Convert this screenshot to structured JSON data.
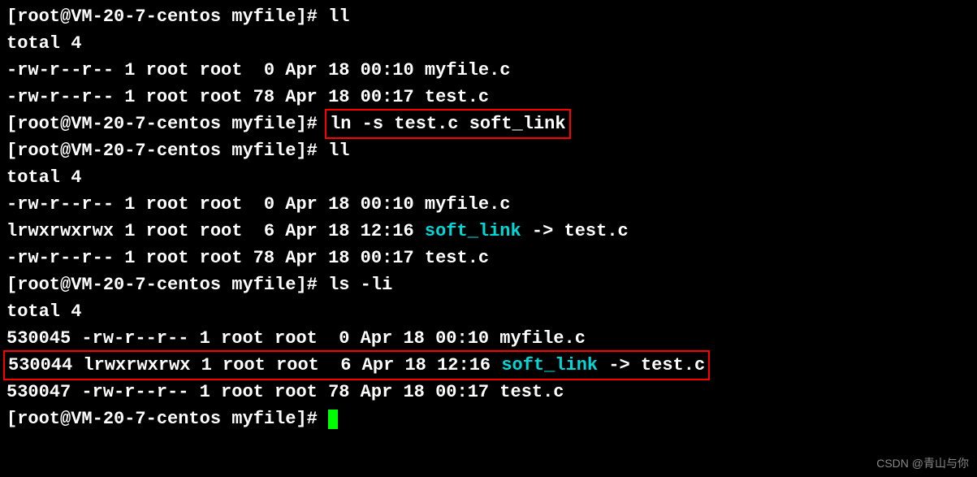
{
  "prompt": "[root@VM-20-7-centos myfile]# ",
  "cmd": {
    "ll1": "ll",
    "ln": "ln -s test.c soft_link",
    "ll2": "ll",
    "lsli": "ls -li"
  },
  "out": {
    "total": "total 4",
    "ll1_r1": "-rw-r--r-- 1 root root  0 Apr 18 00:10 myfile.c",
    "ll1_r2": "-rw-r--r-- 1 root root 78 Apr 18 00:17 test.c",
    "ll2_r1": "-rw-r--r-- 1 root root  0 Apr 18 00:10 myfile.c",
    "ll2_r2_a": "lrwxrwxrwx 1 root root  6 Apr 18 12:16 ",
    "ll2_r2_link": "soft_link",
    "ll2_r2_b": " -> test.c",
    "ll2_r3": "-rw-r--r-- 1 root root 78 Apr 18 00:17 test.c",
    "lsli_r1": "530045 -rw-r--r-- 1 root root  0 Apr 18 00:10 myfile.c",
    "lsli_r2_a": "530044 lrwxrwxrwx 1 root root  6 Apr 18 12:16 ",
    "lsli_r2_link": "soft_link",
    "lsli_r2_b": " -> test.c",
    "lsli_r3": "530047 -rw-r--r-- 1 root root 78 Apr 18 00:17 test.c"
  },
  "watermark": "CSDN @青山与你"
}
